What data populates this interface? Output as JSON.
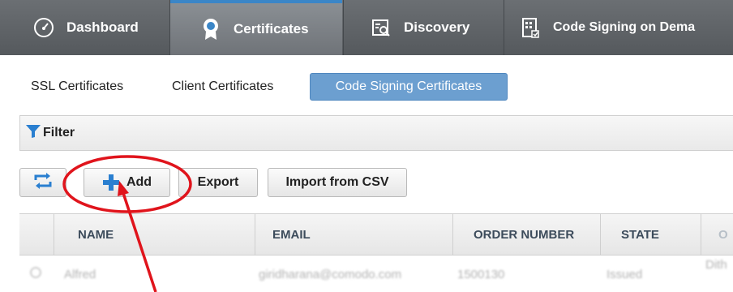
{
  "nav": {
    "tabs": [
      {
        "label": "Dashboard",
        "icon": "gauge-icon"
      },
      {
        "label": "Certificates",
        "icon": "certificate-badge-icon",
        "active": true
      },
      {
        "label": "Discovery",
        "icon": "discovery-icon"
      },
      {
        "label": "Code Signing on Dema",
        "icon": "code-signing-icon"
      }
    ]
  },
  "subtabs": [
    {
      "label": "SSL Certificates"
    },
    {
      "label": "Client Certificates"
    },
    {
      "label": "Code Signing Certificates",
      "active": true
    }
  ],
  "filter": {
    "label": "Filter"
  },
  "toolbar": {
    "add_label": "Add",
    "export_label": "Export",
    "import_label": "Import from CSV"
  },
  "table": {
    "columns": [
      "NAME",
      "EMAIL",
      "ORDER NUMBER",
      "STATE",
      "O"
    ],
    "rows": [
      {
        "name": "Alfred",
        "email": "giridharana@comodo.com",
        "order": "1500130",
        "state": "Issued",
        "other": "Dith"
      }
    ]
  },
  "colors": {
    "nav_bg": "#5f6368",
    "active_accent": "#3b86c7",
    "subtab_active": "#6c9fd0",
    "icon_blue": "#2a7fd0",
    "annotation_red": "#e0141c"
  }
}
